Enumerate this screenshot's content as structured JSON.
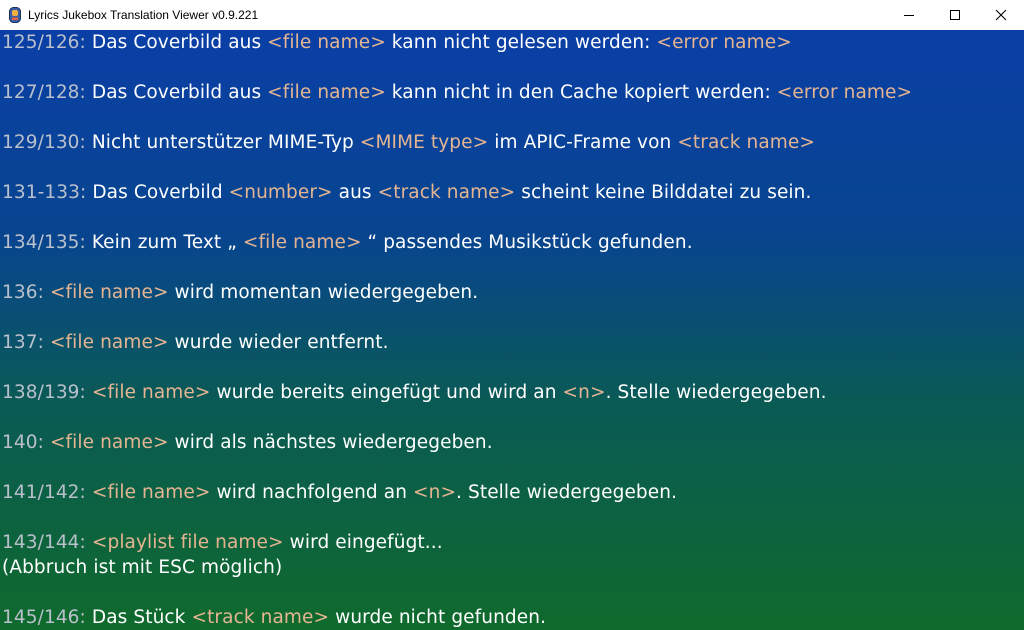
{
  "window": {
    "title": "Lyrics Jukebox Translation Viewer v0.9.221",
    "app_icon": "jukebox-app-icon",
    "controls": [
      "minimize-icon",
      "maximize-icon",
      "close-icon"
    ]
  },
  "entries": [
    {
      "num": "125/126:",
      "t1": " Das Coverbild aus ",
      "p1": "<file name>",
      "t2": " kann nicht gelesen werden:  ",
      "p2": "<error name>"
    },
    {
      "num": "127/128:",
      "t1": " Das Coverbild aus ",
      "p1": "<file name>",
      "t2": " kann nicht in den Cache kopiert werden:  ",
      "p2": "<error name>"
    },
    {
      "num": "129/130:",
      "t1": " Nicht unterstützer MIME-Typ ",
      "p1": "<MIME type>",
      "t2": " im APIC-Frame von ",
      "p2": "<track name>"
    },
    {
      "num": "131-133:",
      "t1": " Das Coverbild ",
      "p1": "<number>",
      "t2": " aus ",
      "p2": "<track name>",
      "t3": " scheint keine Bilddatei zu sein."
    },
    {
      "num": "134/135:",
      "t1": " Kein zum Text „ ",
      "p1": "<file name>",
      "t2": " “ passendes Musikstück gefunden."
    },
    {
      "num": "136:",
      "t1": " ",
      "p1": "<file name>",
      "t2": "  wird momentan wiedergegeben."
    },
    {
      "num": "137:",
      "t1": " ",
      "p1": "<file name>",
      "t2": "  wurde wieder entfernt."
    },
    {
      "num": "138/139:",
      "t1": " ",
      "p1": "<file name>",
      "t2": " wurde bereits eingefügt und wird an ",
      "p2": "<n>",
      "t3": ". Stelle wiedergegeben."
    },
    {
      "num": "140:",
      "t1": " ",
      "p1": "<file name>",
      "t2": "  wird als nächstes wiedergegeben."
    },
    {
      "num": "141/142:",
      "t1": " ",
      "p1": "<file name>",
      "t2": " wird nachfolgend an ",
      "p2": "<n>",
      "t3": ". Stelle wiedergegeben."
    },
    {
      "num": "143/144:",
      "t1": "  ",
      "p1": "<playlist file name>",
      "t2": " wird eingefügt..."
    },
    {
      "num": "",
      "t1": "(Abbruch ist mit ESC möglich)"
    },
    {
      "num": "145/146:",
      "t1": " Das Stück ",
      "p1": "<track name>",
      "t2": " wurde nicht gefunden."
    }
  ],
  "colors": {
    "number": "#b9c0cc",
    "placeholder": "#e5b592",
    "text": "#ffffff",
    "gradient_top": "#0a3fa6",
    "gradient_bottom": "#0f6a2c"
  }
}
